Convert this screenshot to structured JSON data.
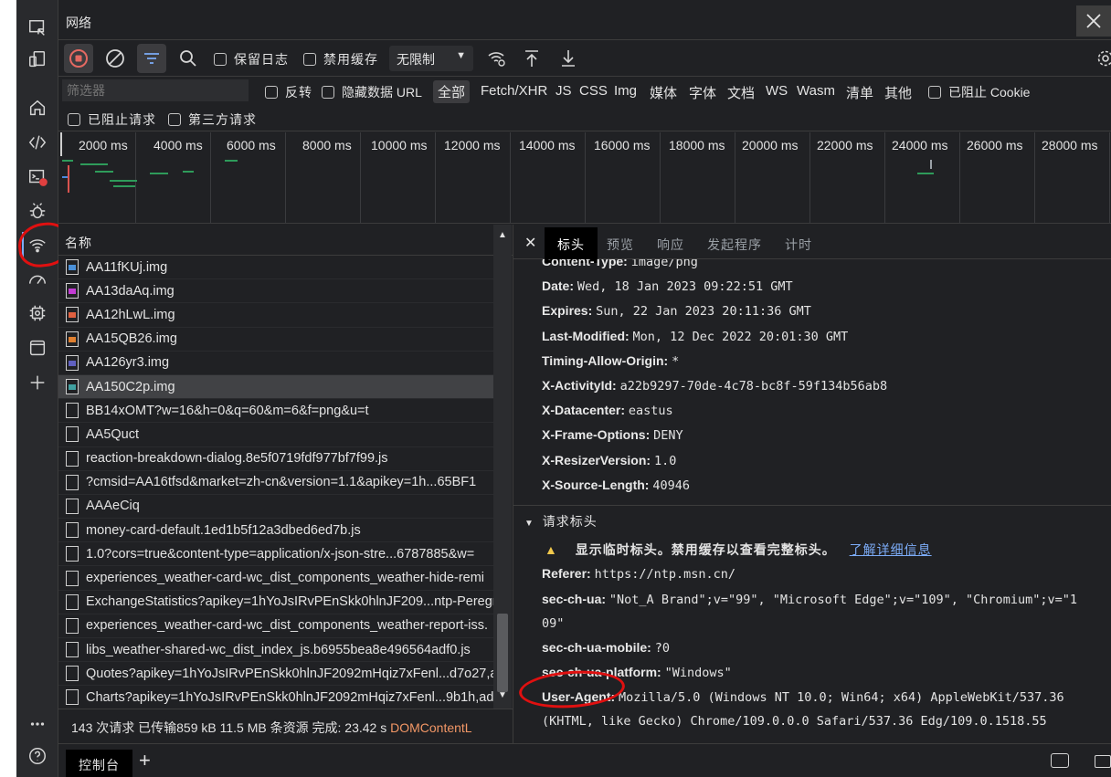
{
  "panel": {
    "title": "网络"
  },
  "toolbar": {
    "preserve_log": "保留日志",
    "disable_cache": "禁用缓存",
    "throttling": "无限制"
  },
  "filter": {
    "placeholder": "筛选器",
    "invert": "反转",
    "hide_data_urls": "隐藏数据 URL",
    "types": [
      "全部",
      "Fetch/XHR",
      "JS",
      "CSS",
      "Img",
      "媒体",
      "字体",
      "文档",
      "WS",
      "Wasm",
      "清单",
      "其他"
    ],
    "blocked_cookies": "已阻止 Cookie",
    "blocked_requests": "已阻止请求",
    "third_party": "第三方请求"
  },
  "timeline": {
    "ticks": [
      "2000 ms",
      "4000 ms",
      "6000 ms",
      "8000 ms",
      "10000 ms",
      "12000 ms",
      "14000 ms",
      "16000 ms",
      "18000 ms",
      "20000 ms",
      "22000 ms",
      "24000 ms",
      "26000 ms",
      "28000 ms"
    ]
  },
  "requests": {
    "column_name": "名称",
    "rows": [
      {
        "name": "AA11fKUj.img",
        "kind": "img",
        "color": "#4a90d9"
      },
      {
        "name": "AA13daAq.img",
        "kind": "img",
        "color": "#c23bd4"
      },
      {
        "name": "AA12hLwL.img",
        "kind": "img",
        "color": "#e06040"
      },
      {
        "name": "AA15QB26.img",
        "kind": "img",
        "color": "#e08030"
      },
      {
        "name": "AA126yr3.img",
        "kind": "img",
        "color": "#6060c0"
      },
      {
        "name": "AA150C2p.img",
        "kind": "img",
        "color": "#40a0a0",
        "selected": true
      },
      {
        "name": "BB14xOMT?w=16&h=0&q=60&m=6&f=png&u=t",
        "kind": "doc"
      },
      {
        "name": "AA5Quct",
        "kind": "doc"
      },
      {
        "name": "reaction-breakdown-dialog.8e5f0719fdf977bf7f99.js",
        "kind": "doc"
      },
      {
        "name": "?cmsid=AA16tfsd&market=zh-cn&version=1.1&apikey=1h...65BF1",
        "kind": "doc"
      },
      {
        "name": "AAAeCiq",
        "kind": "doc"
      },
      {
        "name": "money-card-default.1ed1b5f12a3dbed6ed7b.js",
        "kind": "doc"
      },
      {
        "name": "1.0?cors=true&content-type=application/x-json-stre...6787885&w=",
        "kind": "doc"
      },
      {
        "name": "experiences_weather-card-wc_dist_components_weather-hide-remi",
        "kind": "doc"
      },
      {
        "name": "ExchangeStatistics?apikey=1hYoJsIRvPEnSkk0hlnJF209...ntp-Peregri",
        "kind": "doc"
      },
      {
        "name": "experiences_weather-card-wc_dist_components_weather-report-iss.",
        "kind": "doc"
      },
      {
        "name": "libs_weather-shared-wc_dist_index_js.b6955bea8e496564adf0.js",
        "kind": "doc"
      },
      {
        "name": "Quotes?apikey=1hYoJsIRvPEnSkk0hlnJF2092mHqiz7xFenl...d7o27,a.",
        "kind": "doc"
      },
      {
        "name": "Charts?apikey=1hYoJsIRvPEnSkk0hlnJF2092mHqiz7xFenl...9b1h,adc",
        "kind": "doc"
      }
    ]
  },
  "status": {
    "requests": "143 次请求",
    "transferred": "已传输859 kB",
    "resources": "11.5 MB 条资源",
    "finish": "完成: 23.42 s",
    "dcl": "DOMContentL"
  },
  "details": {
    "tabs": [
      "标头",
      "预览",
      "响应",
      "发起程序",
      "计时"
    ],
    "response_headers": [
      {
        "k": "Content-Type:",
        "v": "image/png"
      },
      {
        "k": "Date:",
        "v": "Wed, 18 Jan 2023 09:22:51 GMT"
      },
      {
        "k": "Expires:",
        "v": "Sun, 22 Jan 2023 20:11:36 GMT"
      },
      {
        "k": "Last-Modified:",
        "v": "Mon, 12 Dec 2022 20:01:30 GMT"
      },
      {
        "k": "Timing-Allow-Origin:",
        "v": "*"
      },
      {
        "k": "X-ActivityId:",
        "v": "a22b9297-70de-4c78-bc8f-59f134b56ab8"
      },
      {
        "k": "X-Datacenter:",
        "v": "eastus"
      },
      {
        "k": "X-Frame-Options:",
        "v": "DENY"
      },
      {
        "k": "X-ResizerVersion:",
        "v": "1.0"
      },
      {
        "k": "X-Source-Length:",
        "v": "40946"
      }
    ],
    "request_section": "请求标头",
    "warning_text": "显示临时标头。禁用缓存以查看完整标头。",
    "warning_link": "了解详细信息",
    "request_headers": {
      "referer_k": "Referer:",
      "referer_v": "https://ntp.msn.cn/",
      "ua_k": "sec-ch-ua:",
      "ua_v1": "\"Not_A Brand\";v=\"99\", \"Microsoft Edge\";v=\"109\", \"Chromium\";v=\"1",
      "ua_v2": "09\"",
      "mobile_k": "sec-ch-ua-mobile:",
      "mobile_v": "?0",
      "platform_k": "sec-ch-ua-platform:",
      "platform_v": "\"Windows\"",
      "agent_k": "User-Agent:",
      "agent_v1": "Mozilla/5.0 (Windows NT 10.0; Win64; x64) AppleWebKit/537.36",
      "agent_v2": "(KHTML, like Gecko) Chrome/109.0.0.0 Safari/537.36 Edg/109.0.1518.55"
    }
  },
  "drawer": {
    "console_tab": "控制台"
  },
  "colors": {
    "accent": "#7cacf8",
    "record": "#e46962",
    "annotation": "#e01010"
  }
}
